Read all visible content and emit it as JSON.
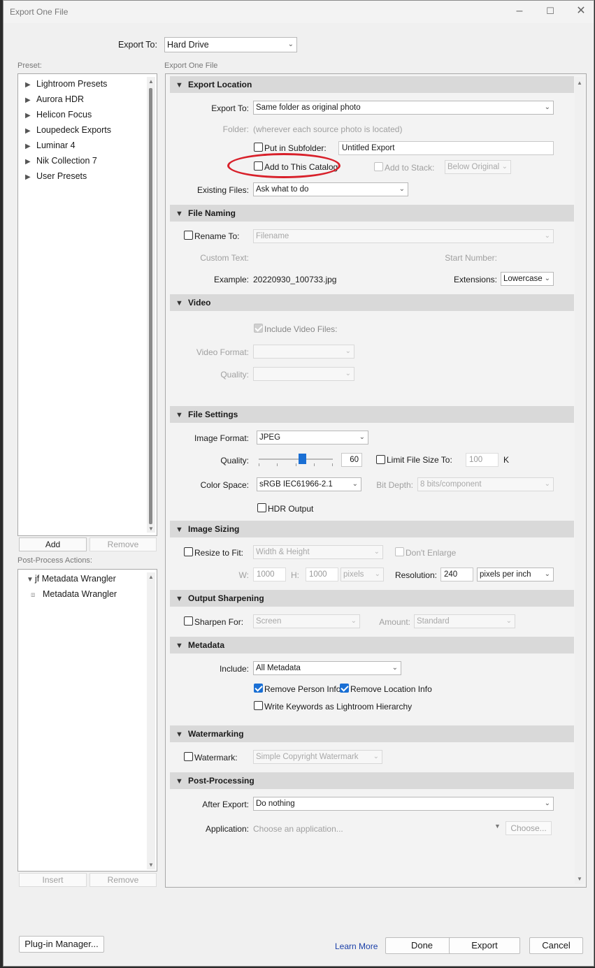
{
  "window": {
    "title": "Export One File"
  },
  "top": {
    "export_to_label": "Export To:",
    "export_to_value": "Hard Drive",
    "preset_label": "Preset:",
    "panel_label": "Export One File"
  },
  "presets": {
    "items": [
      "Lightroom Presets",
      "Aurora HDR",
      "Helicon Focus",
      "Loupedeck Exports",
      "Luminar 4",
      "Nik Collection 7",
      "User Presets"
    ],
    "add_label": "Add",
    "remove_label": "Remove"
  },
  "postprocess": {
    "label": "Post-Process Actions:",
    "parent": "jf Metadata Wrangler",
    "child": "Metadata Wrangler",
    "insert_label": "Insert",
    "remove_label": "Remove"
  },
  "export_location": {
    "header": "Export Location",
    "export_to_label": "Export To:",
    "export_to_value": "Same folder as original photo",
    "folder_label": "Folder:",
    "folder_value": "(wherever each source photo is located)",
    "subfolder_label": "Put in Subfolder:",
    "subfolder_value": "Untitled Export",
    "add_catalog_label": "Add to This Catalog",
    "add_stack_label": "Add to Stack:",
    "stack_value": "Below Original",
    "existing_label": "Existing Files:",
    "existing_value": "Ask what to do"
  },
  "file_naming": {
    "header": "File Naming",
    "rename_label": "Rename To:",
    "rename_value": "Filename",
    "custom_text_label": "Custom Text:",
    "start_number_label": "Start Number:",
    "example_label": "Example:",
    "example_value": "20220930_100733.jpg",
    "extensions_label": "Extensions:",
    "extensions_value": "Lowercase"
  },
  "video": {
    "header": "Video",
    "include_label": "Include Video Files:",
    "format_label": "Video Format:",
    "quality_label": "Quality:"
  },
  "file_settings": {
    "header": "File Settings",
    "format_label": "Image Format:",
    "format_value": "JPEG",
    "quality_label": "Quality:",
    "quality_value": "60",
    "quality_fraction": 0.6,
    "limit_label": "Limit File Size To:",
    "limit_value": "100",
    "limit_unit": "K",
    "color_space_label": "Color Space:",
    "color_space_value": "sRGB IEC61966-2.1",
    "bit_depth_label": "Bit Depth:",
    "bit_depth_value": "8 bits/component",
    "hdr_label": "HDR Output"
  },
  "image_sizing": {
    "header": "Image Sizing",
    "resize_label": "Resize to Fit:",
    "resize_value": "Width & Height",
    "dont_enlarge_label": "Don't Enlarge",
    "w_label": "W:",
    "w_value": "1000",
    "h_label": "H:",
    "h_value": "1000",
    "unit_value": "pixels",
    "resolution_label": "Resolution:",
    "resolution_value": "240",
    "resolution_unit": "pixels per inch"
  },
  "sharpening": {
    "header": "Output Sharpening",
    "sharpen_label": "Sharpen For:",
    "sharpen_value": "Screen",
    "amount_label": "Amount:",
    "amount_value": "Standard"
  },
  "metadata": {
    "header": "Metadata",
    "include_label": "Include:",
    "include_value": "All Metadata",
    "remove_person_label": "Remove Person Info",
    "remove_location_label": "Remove Location Info",
    "keywords_label": "Write Keywords as Lightroom Hierarchy"
  },
  "watermarking": {
    "header": "Watermarking",
    "watermark_label": "Watermark:",
    "watermark_value": "Simple Copyright Watermark"
  },
  "post_processing": {
    "header": "Post-Processing",
    "after_export_label": "After Export:",
    "after_export_value": "Do nothing",
    "application_label": "Application:",
    "application_placeholder": "Choose an application...",
    "choose_label": "Choose..."
  },
  "footer": {
    "plugin_manager": "Plug-in Manager...",
    "learn_more": "Learn More",
    "done": "Done",
    "export": "Export",
    "cancel": "Cancel"
  },
  "colors": {
    "accent": "#1a6fd4",
    "highlight_ellipse": "#d8202a"
  }
}
